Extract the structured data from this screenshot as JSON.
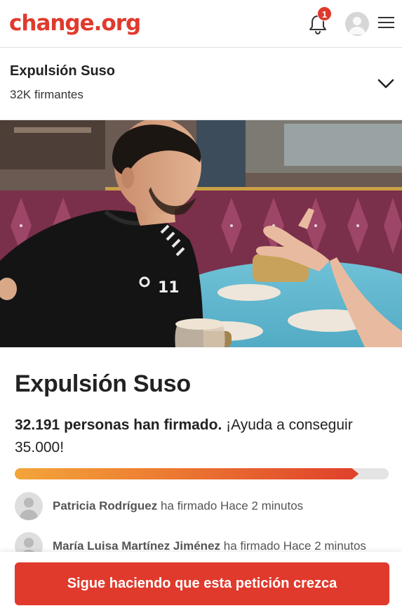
{
  "header": {
    "logo_text": "change.org",
    "notification_count": "1",
    "brand_color": "#e03a2d",
    "icons": [
      "bell-icon",
      "user-avatar-icon",
      "hamburger-menu-icon"
    ]
  },
  "petition_bar": {
    "title": "Expulsión Suso",
    "signers_short": "32K firmantes",
    "icon": "chevron-down-icon"
  },
  "petition": {
    "title": "Expulsión Suso",
    "signed_bold": "32.191 personas han firmado.",
    "goal_text": " ¡Ayuda a conseguir 35.000!",
    "progress_fraction": 0.92
  },
  "signers": [
    {
      "name": "Patricia Rodríguez",
      "action": " ha firmado ",
      "time": "Hace 2 minutos"
    },
    {
      "name": "María Luisa Martínez Jiménez",
      "action": " ha firmado ",
      "time": "Hace 2 minutos"
    }
  ],
  "cta": {
    "label": "Sigue haciendo que esta petición crezca"
  }
}
